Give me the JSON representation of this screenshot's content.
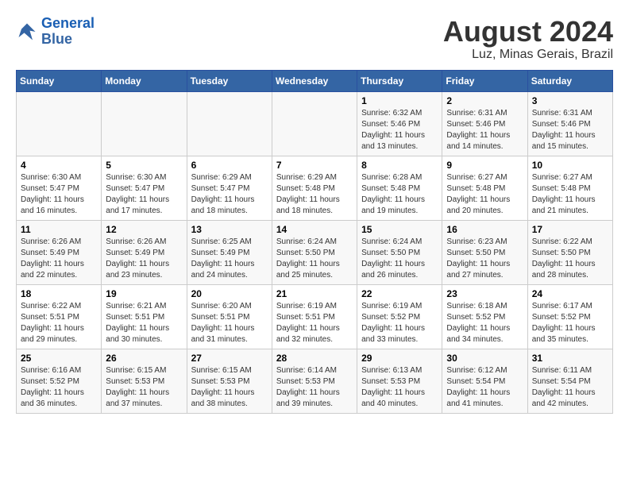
{
  "logo": {
    "line1": "General",
    "line2": "Blue"
  },
  "title": "August 2024",
  "subtitle": "Luz, Minas Gerais, Brazil",
  "headers": [
    "Sunday",
    "Monday",
    "Tuesday",
    "Wednesday",
    "Thursday",
    "Friday",
    "Saturday"
  ],
  "weeks": [
    [
      {
        "day": "",
        "info": ""
      },
      {
        "day": "",
        "info": ""
      },
      {
        "day": "",
        "info": ""
      },
      {
        "day": "",
        "info": ""
      },
      {
        "day": "1",
        "info": "Sunrise: 6:32 AM\nSunset: 5:46 PM\nDaylight: 11 hours\nand 13 minutes."
      },
      {
        "day": "2",
        "info": "Sunrise: 6:31 AM\nSunset: 5:46 PM\nDaylight: 11 hours\nand 14 minutes."
      },
      {
        "day": "3",
        "info": "Sunrise: 6:31 AM\nSunset: 5:46 PM\nDaylight: 11 hours\nand 15 minutes."
      }
    ],
    [
      {
        "day": "4",
        "info": "Sunrise: 6:30 AM\nSunset: 5:47 PM\nDaylight: 11 hours\nand 16 minutes."
      },
      {
        "day": "5",
        "info": "Sunrise: 6:30 AM\nSunset: 5:47 PM\nDaylight: 11 hours\nand 17 minutes."
      },
      {
        "day": "6",
        "info": "Sunrise: 6:29 AM\nSunset: 5:47 PM\nDaylight: 11 hours\nand 18 minutes."
      },
      {
        "day": "7",
        "info": "Sunrise: 6:29 AM\nSunset: 5:48 PM\nDaylight: 11 hours\nand 18 minutes."
      },
      {
        "day": "8",
        "info": "Sunrise: 6:28 AM\nSunset: 5:48 PM\nDaylight: 11 hours\nand 19 minutes."
      },
      {
        "day": "9",
        "info": "Sunrise: 6:27 AM\nSunset: 5:48 PM\nDaylight: 11 hours\nand 20 minutes."
      },
      {
        "day": "10",
        "info": "Sunrise: 6:27 AM\nSunset: 5:48 PM\nDaylight: 11 hours\nand 21 minutes."
      }
    ],
    [
      {
        "day": "11",
        "info": "Sunrise: 6:26 AM\nSunset: 5:49 PM\nDaylight: 11 hours\nand 22 minutes."
      },
      {
        "day": "12",
        "info": "Sunrise: 6:26 AM\nSunset: 5:49 PM\nDaylight: 11 hours\nand 23 minutes."
      },
      {
        "day": "13",
        "info": "Sunrise: 6:25 AM\nSunset: 5:49 PM\nDaylight: 11 hours\nand 24 minutes."
      },
      {
        "day": "14",
        "info": "Sunrise: 6:24 AM\nSunset: 5:50 PM\nDaylight: 11 hours\nand 25 minutes."
      },
      {
        "day": "15",
        "info": "Sunrise: 6:24 AM\nSunset: 5:50 PM\nDaylight: 11 hours\nand 26 minutes."
      },
      {
        "day": "16",
        "info": "Sunrise: 6:23 AM\nSunset: 5:50 PM\nDaylight: 11 hours\nand 27 minutes."
      },
      {
        "day": "17",
        "info": "Sunrise: 6:22 AM\nSunset: 5:50 PM\nDaylight: 11 hours\nand 28 minutes."
      }
    ],
    [
      {
        "day": "18",
        "info": "Sunrise: 6:22 AM\nSunset: 5:51 PM\nDaylight: 11 hours\nand 29 minutes."
      },
      {
        "day": "19",
        "info": "Sunrise: 6:21 AM\nSunset: 5:51 PM\nDaylight: 11 hours\nand 30 minutes."
      },
      {
        "day": "20",
        "info": "Sunrise: 6:20 AM\nSunset: 5:51 PM\nDaylight: 11 hours\nand 31 minutes."
      },
      {
        "day": "21",
        "info": "Sunrise: 6:19 AM\nSunset: 5:51 PM\nDaylight: 11 hours\nand 32 minutes."
      },
      {
        "day": "22",
        "info": "Sunrise: 6:19 AM\nSunset: 5:52 PM\nDaylight: 11 hours\nand 33 minutes."
      },
      {
        "day": "23",
        "info": "Sunrise: 6:18 AM\nSunset: 5:52 PM\nDaylight: 11 hours\nand 34 minutes."
      },
      {
        "day": "24",
        "info": "Sunrise: 6:17 AM\nSunset: 5:52 PM\nDaylight: 11 hours\nand 35 minutes."
      }
    ],
    [
      {
        "day": "25",
        "info": "Sunrise: 6:16 AM\nSunset: 5:52 PM\nDaylight: 11 hours\nand 36 minutes."
      },
      {
        "day": "26",
        "info": "Sunrise: 6:15 AM\nSunset: 5:53 PM\nDaylight: 11 hours\nand 37 minutes."
      },
      {
        "day": "27",
        "info": "Sunrise: 6:15 AM\nSunset: 5:53 PM\nDaylight: 11 hours\nand 38 minutes."
      },
      {
        "day": "28",
        "info": "Sunrise: 6:14 AM\nSunset: 5:53 PM\nDaylight: 11 hours\nand 39 minutes."
      },
      {
        "day": "29",
        "info": "Sunrise: 6:13 AM\nSunset: 5:53 PM\nDaylight: 11 hours\nand 40 minutes."
      },
      {
        "day": "30",
        "info": "Sunrise: 6:12 AM\nSunset: 5:54 PM\nDaylight: 11 hours\nand 41 minutes."
      },
      {
        "day": "31",
        "info": "Sunrise: 6:11 AM\nSunset: 5:54 PM\nDaylight: 11 hours\nand 42 minutes."
      }
    ]
  ]
}
